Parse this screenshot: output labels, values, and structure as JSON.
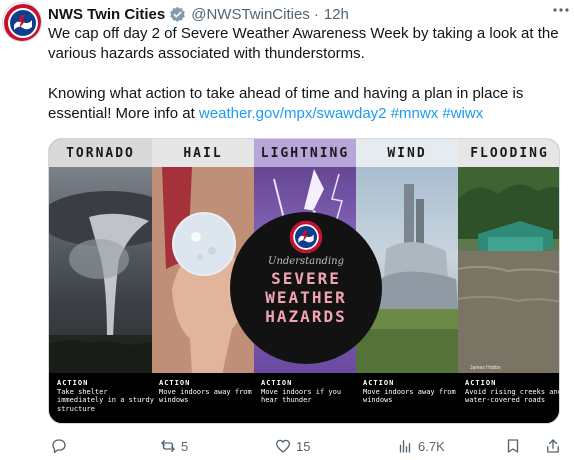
{
  "tweet": {
    "display_name": "NWS Twin Cities",
    "handle": "@NWSTwinCities",
    "separator": "·",
    "time": "12h",
    "more_icon": "more-dots-icon",
    "paragraph1": "We cap off day 2 of Severe Weather Awareness Week by taking a look at the various hazards associated with thunderstorms.",
    "paragraph2_text": "Knowing what action to take ahead of time and having a plan in place is essential! More info at ",
    "link_url": "weather.gov/mpx/swawday2",
    "hashtag1": "#mnwx",
    "hashtag2": "#wiwx",
    "avatar_text": "NATIONAL WEATHER"
  },
  "infographic": {
    "panels": [
      {
        "title": "TORNADO",
        "action_head": "ACTION",
        "action_text": "Take shelter immediately in a sturdy structure"
      },
      {
        "title": "HAIL",
        "action_head": "ACTION",
        "action_text": "Move indoors away from windows"
      },
      {
        "title": "LIGHTNING",
        "action_head": "ACTION",
        "action_text": "Move indoors if you hear thunder"
      },
      {
        "title": "WIND",
        "action_head": "ACTION",
        "action_text": "Move indoors away from windows"
      },
      {
        "title": "FLOODING",
        "action_head": "ACTION",
        "action_text": "Avoid rising creeks and water-covered roads"
      }
    ],
    "understanding": "Understanding",
    "title_line1": "SEVERE",
    "title_line2": "WEATHER",
    "title_line3": "HAZARDS",
    "photo_credit": "James Hobbs"
  },
  "engagement": {
    "replies_icon": "reply-icon",
    "retweets": "5",
    "likes": "15",
    "views": "6.7K"
  },
  "colors": {
    "link": "#1d9bf0",
    "text": "#0f1419",
    "muted": "#536471",
    "verified": "#829aab",
    "title_pink": "#f2a3b3"
  }
}
